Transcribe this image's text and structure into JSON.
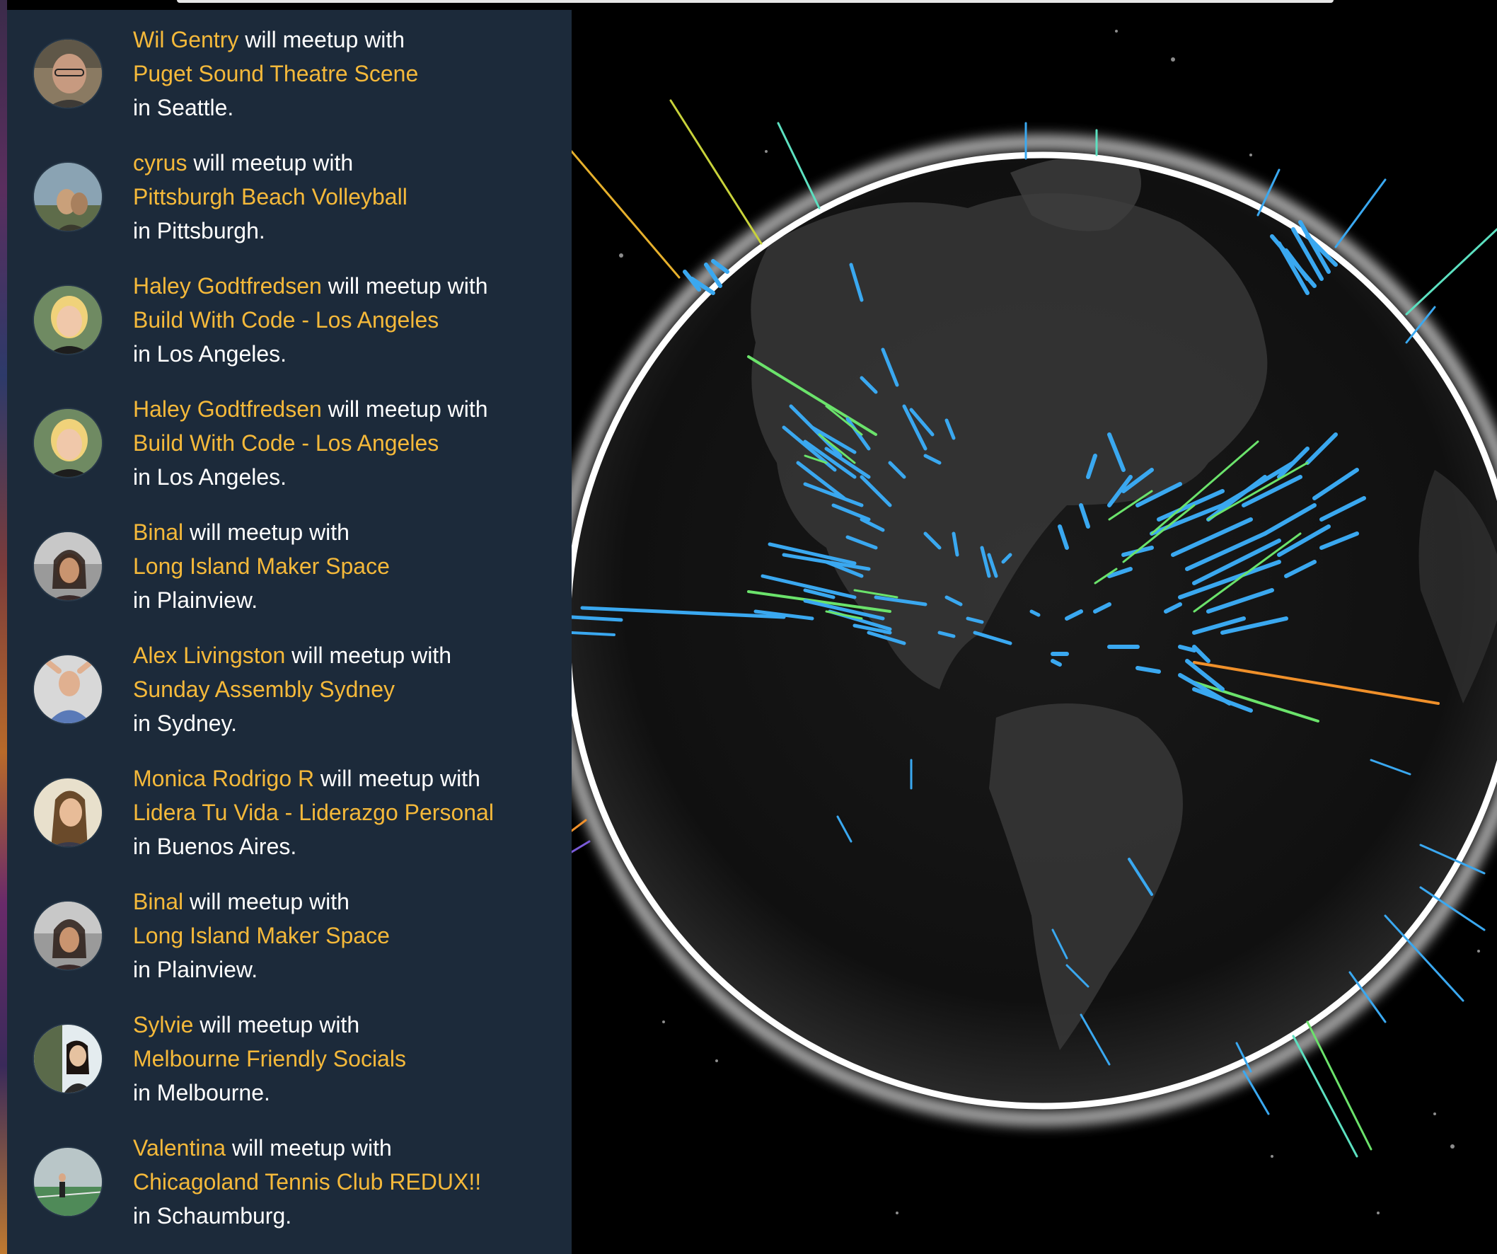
{
  "colors": {
    "panel_bg": "#1c2a3a",
    "highlight": "#f5b93a",
    "text": "#ffffff",
    "background": "#000000",
    "globe_rim": "#ffffff",
    "spike_blue": "#3aa8f0",
    "spike_green": "#6be36b",
    "spike_orange": "#f0902a"
  },
  "feed": {
    "connector": "will meetup with",
    "city_prefix": "in",
    "items": [
      {
        "name": "Wil Gentry",
        "group": "Puget Sound Theatre Scene",
        "city": "Seattle."
      },
      {
        "name": "cyrus",
        "group": "Pittsburgh Beach Volleyball",
        "city": "Pittsburgh."
      },
      {
        "name": "Haley Godtfredsen",
        "group": "Build With Code - Los Angeles",
        "city": "Los Angeles."
      },
      {
        "name": "Haley Godtfredsen",
        "group": "Build With Code - Los Angeles",
        "city": "Los Angeles."
      },
      {
        "name": "Binal",
        "group": "Long Island Maker Space",
        "city": "Plainview."
      },
      {
        "name": "Alex Livingston",
        "group": "Sunday Assembly Sydney",
        "city": "Sydney."
      },
      {
        "name": "Monica Rodrigo R",
        "group": "Lidera Tu Vida - Liderazgo Personal",
        "city": "Buenos Aires."
      },
      {
        "name": "Binal",
        "group": "Long Island Maker Space",
        "city": "Plainview."
      },
      {
        "name": "Sylvie",
        "group": "Melbourne Friendly Socials",
        "city": "Melbourne."
      },
      {
        "name": "Valentina",
        "group": "Chicagoland Tennis Club REDUX!!",
        "city": "Schaumburg."
      }
    ]
  }
}
